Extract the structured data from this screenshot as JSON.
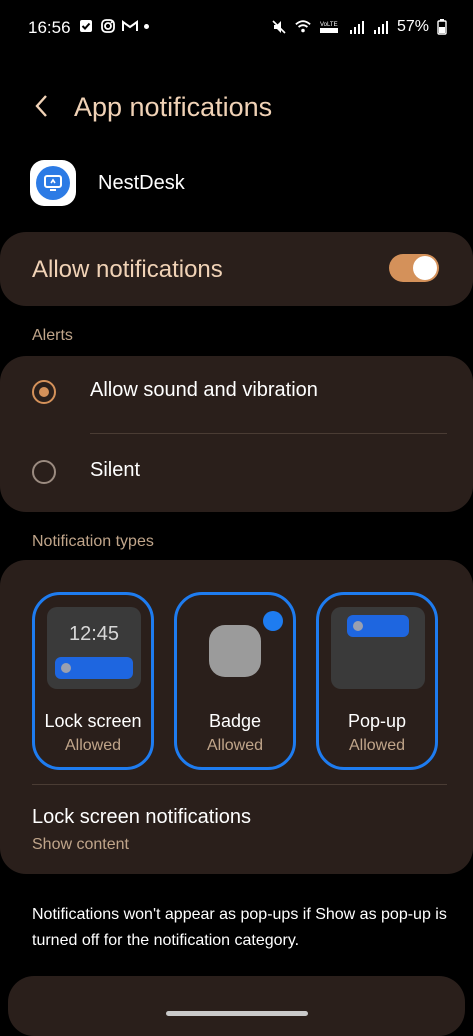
{
  "status_bar": {
    "time": "16:56",
    "battery": "57%"
  },
  "header": {
    "title": "App notifications"
  },
  "app": {
    "name": "NestDesk"
  },
  "allow_notifications": {
    "label": "Allow notifications",
    "enabled": true
  },
  "alerts": {
    "section_label": "Alerts",
    "options": [
      {
        "label": "Allow sound and vibration",
        "selected": true
      },
      {
        "label": "Silent",
        "selected": false
      }
    ]
  },
  "notification_types": {
    "section_label": "Notification types",
    "items": [
      {
        "name": "Lock screen",
        "status": "Allowed",
        "preview_time": "12:45"
      },
      {
        "name": "Badge",
        "status": "Allowed"
      },
      {
        "name": "Pop-up",
        "status": "Allowed"
      }
    ],
    "lock_screen_notifications": {
      "title": "Lock screen notifications",
      "value": "Show content"
    }
  },
  "footer_note": "Notifications won't appear as pop-ups if Show as pop-up is turned off for the notification category.",
  "colors": {
    "accent": "#d4915a",
    "title_text": "#f0d2b6",
    "card_bg": "#2a1f1b",
    "selection_blue": "#1e7cf0"
  }
}
